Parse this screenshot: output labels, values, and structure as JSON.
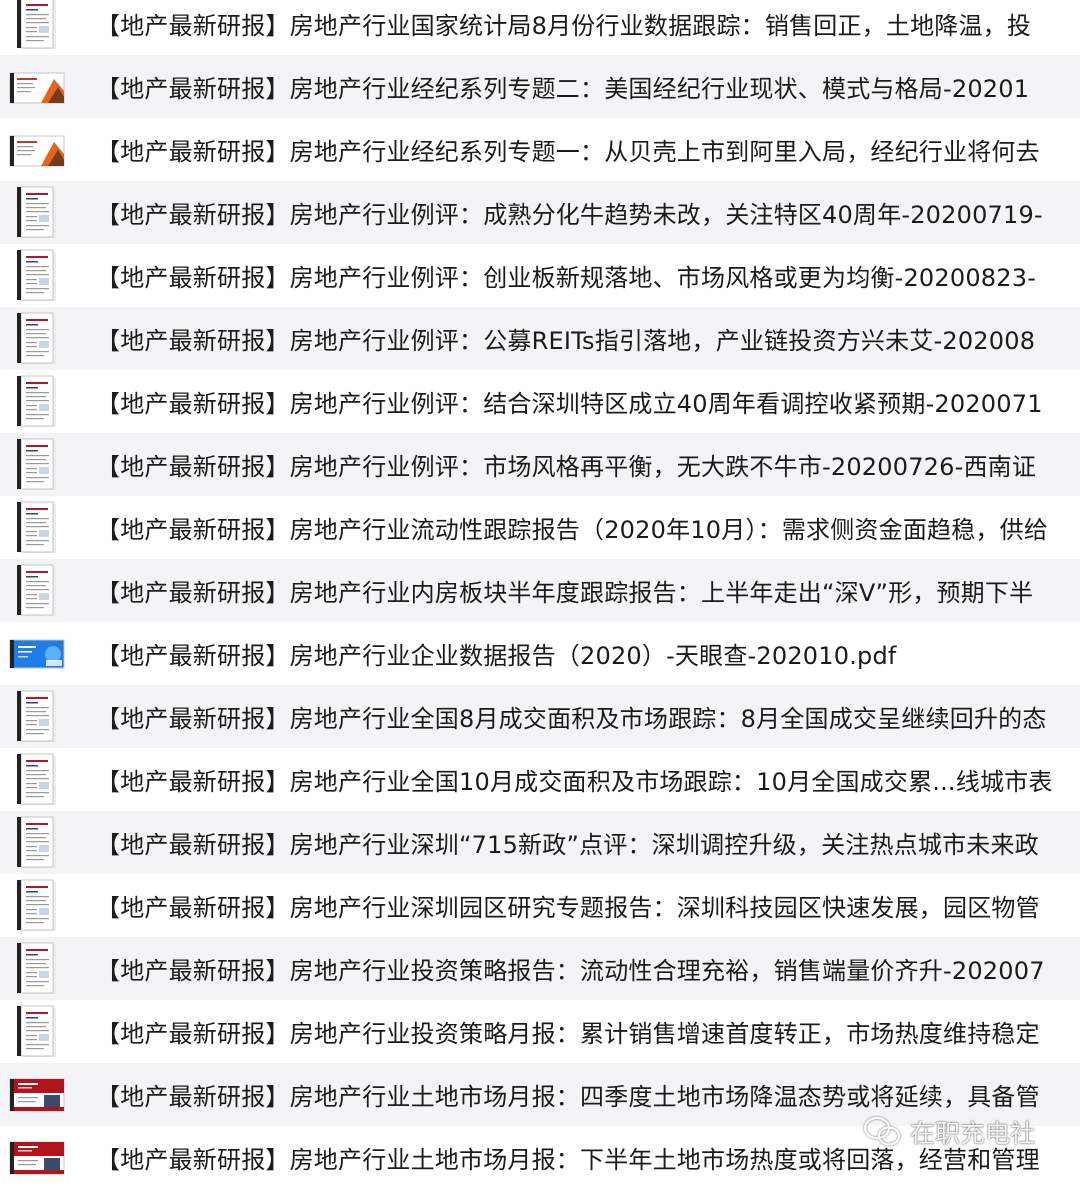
{
  "files": [
    {
      "name": "【地产最新研报】房地产行业国家统计局8月份行业数据跟踪：销售回正，土地降温，投",
      "icon": "document-icon"
    },
    {
      "name": "【地产最新研报】房地产行业经纪系列专题二：美国经纪行业现状、模式与格局-20201",
      "icon": "slide-icon"
    },
    {
      "name": "【地产最新研报】房地产行业经纪系列专题一：从贝壳上市到阿里入局，经纪行业将何去",
      "icon": "slide-icon"
    },
    {
      "name": "【地产最新研报】房地产行业例评：成熟分化牛趋势未改，关注特区40周年-20200719-",
      "icon": "document-icon"
    },
    {
      "name": "【地产最新研报】房地产行业例评：创业板新规落地、市场风格或更为均衡-20200823-",
      "icon": "document-icon"
    },
    {
      "name": "【地产最新研报】房地产行业例评：公募REITs指引落地，产业链投资方兴未艾-202008",
      "icon": "document-icon"
    },
    {
      "name": "【地产最新研报】房地产行业例评：结合深圳特区成立40周年看调控收紧预期-2020071",
      "icon": "document-icon"
    },
    {
      "name": "【地产最新研报】房地产行业例评：市场风格再平衡，无大跌不牛市-20200726-西南证",
      "icon": "document-icon"
    },
    {
      "name": "【地产最新研报】房地产行业流动性跟踪报告（2020年10月）：需求侧资金面趋稳，供给",
      "icon": "document-icon"
    },
    {
      "name": "【地产最新研报】房地产行业内房板块半年度跟踪报告：上半年走出“深V”形，预期下半",
      "icon": "document-icon"
    },
    {
      "name": "【地产最新研报】房地产行业企业数据报告（2020）-天眼查-202010.pdf",
      "icon": "blue-cover-icon"
    },
    {
      "name": "【地产最新研报】房地产行业全国8月成交面积及市场跟踪：8月全国成交呈继续回升的态",
      "icon": "document-icon"
    },
    {
      "name": "【地产最新研报】房地产行业全国10月成交面积及市场跟踪：10月全国成交累...线城市表",
      "icon": "document-icon"
    },
    {
      "name": "【地产最新研报】房地产行业深圳“715新政”点评：深圳调控升级，关注热点城市未来政",
      "icon": "document-icon"
    },
    {
      "name": "【地产最新研报】房地产行业深圳园区研究专题报告：深圳科技园区快速发展，园区物管",
      "icon": "document-icon"
    },
    {
      "name": "【地产最新研报】房地产行业投资策略报告：流动性合理充裕，销售端量价齐升-202007",
      "icon": "document-icon"
    },
    {
      "name": "【地产最新研报】房地产行业投资策略月报：累计销售增速首度转正，市场热度维持稳定",
      "icon": "document-icon"
    },
    {
      "name": "【地产最新研报】房地产行业土地市场月报：四季度土地市场降温态势或将延续，具备管",
      "icon": "red-cover-icon"
    },
    {
      "name": "【地产最新研报】房地产行业土地市场月报：下半年土地市场热度或将回落，经营和管理",
      "icon": "red-cover-icon"
    }
  ],
  "watermark": {
    "text": "在职充电社",
    "icon": "wechat-icon"
  },
  "colors": {
    "row_alt": "#f4f4f6",
    "text": "#1b1b1b"
  }
}
